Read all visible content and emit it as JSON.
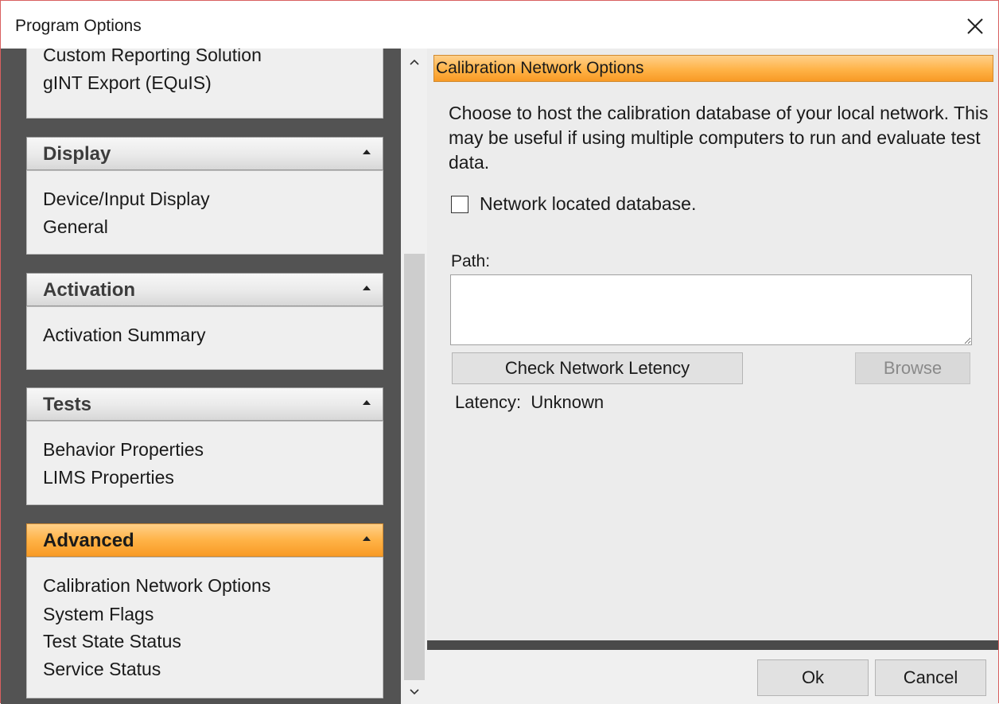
{
  "window": {
    "title": "Program Options"
  },
  "nav": {
    "top_group_items": [
      "Custom Reporting Solution",
      "gINT Export (EQuIS)"
    ],
    "groups": [
      {
        "title": "Display",
        "items": [
          "Device/Input Display",
          "General"
        ]
      },
      {
        "title": "Activation",
        "items": [
          "Activation Summary"
        ]
      },
      {
        "title": "Tests",
        "items": [
          "Behavior Properties",
          "LIMS Properties"
        ]
      },
      {
        "title": "Advanced",
        "items": [
          "Calibration Network Options",
          "System Flags",
          "Test State Status",
          "Service Status"
        ]
      }
    ],
    "active_group": "Advanced"
  },
  "content": {
    "header": "Calibration Network Options",
    "description": "Choose to host the calibration database of your local network.  This may be useful if using multiple computers to run and evaluate test data.",
    "checkbox_label": "Network located database.",
    "checkbox_checked": false,
    "path_label": "Path:",
    "path_value": "",
    "check_button": "Check Network Letency",
    "browse_button": "Browse",
    "latency_text": "Latency:  Unknown"
  },
  "footer": {
    "ok": "Ok",
    "cancel": "Cancel"
  },
  "colors": {
    "accent": "#ffb347",
    "nav_background": "#535353"
  },
  "icons": {
    "close": "close-icon",
    "collapse": "chevron-up-icon",
    "scroll_up": "scroll-up-icon",
    "scroll_down": "scroll-down-icon"
  }
}
